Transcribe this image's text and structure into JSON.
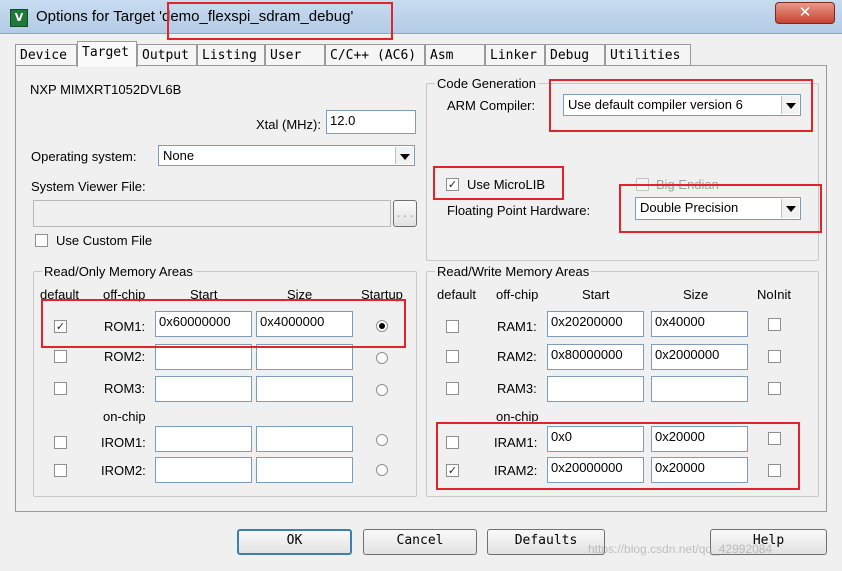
{
  "window": {
    "title_prefix": "Options for Target ",
    "title_target": "'demo_flexspi_sdram_debug'",
    "app_icon": "keil-icon",
    "close_label": "✕"
  },
  "tabs": [
    "Device",
    "Target",
    "Output",
    "Listing",
    "User",
    "C/C++ (AC6)",
    "Asm",
    "Linker",
    "Debug",
    "Utilities"
  ],
  "active_tab": "Target",
  "device_name": "NXP MIMXRT1052DVL6B",
  "xtal": {
    "label": "Xtal (MHz):",
    "value": "12.0"
  },
  "os": {
    "label": "Operating system:",
    "value": "None"
  },
  "svd": {
    "label": "System Viewer File:",
    "value": "",
    "browse_label": "..."
  },
  "use_custom_file": {
    "label": "Use Custom File",
    "checked": false
  },
  "code_generation": {
    "title": "Code Generation",
    "arm_compiler_label": "ARM Compiler:",
    "arm_compiler_value": "Use default compiler version 6",
    "use_microlib_label": "Use MicroLIB",
    "use_microlib_checked": true,
    "big_endian_label": "Big Endian",
    "big_endian_checked": false,
    "fph_label": "Floating Point Hardware:",
    "fph_value": "Double Precision"
  },
  "ro_memory": {
    "title": "Read/Only Memory Areas",
    "headers": {
      "default": "default",
      "offchip": "off-chip",
      "start": "Start",
      "size": "Size",
      "startup": "Startup"
    },
    "onchip_label": "on-chip",
    "rows": [
      {
        "label": "ROM1:",
        "default": true,
        "start": "0x60000000",
        "size": "0x4000000",
        "startup": true
      },
      {
        "label": "ROM2:",
        "default": false,
        "start": "",
        "size": "",
        "startup": false
      },
      {
        "label": "ROM3:",
        "default": false,
        "start": "",
        "size": "",
        "startup": false
      },
      {
        "label": "IROM1:",
        "default": false,
        "start": "",
        "size": "",
        "startup": false
      },
      {
        "label": "IROM2:",
        "default": false,
        "start": "",
        "size": "",
        "startup": false
      }
    ]
  },
  "rw_memory": {
    "title": "Read/Write Memory Areas",
    "headers": {
      "default": "default",
      "offchip": "off-chip",
      "start": "Start",
      "size": "Size",
      "noinit": "NoInit"
    },
    "onchip_label": "on-chip",
    "rows": [
      {
        "label": "RAM1:",
        "default": false,
        "start": "0x20200000",
        "size": "0x40000",
        "noinit": false
      },
      {
        "label": "RAM2:",
        "default": false,
        "start": "0x80000000",
        "size": "0x2000000",
        "noinit": false
      },
      {
        "label": "RAM3:",
        "default": false,
        "start": "",
        "size": "",
        "noinit": false
      },
      {
        "label": "IRAM1:",
        "default": false,
        "start": "0x0",
        "size": "0x20000",
        "noinit": false
      },
      {
        "label": "IRAM2:",
        "default": true,
        "start": "0x20000000",
        "size": "0x20000",
        "noinit": false
      }
    ]
  },
  "buttons": {
    "ok": "OK",
    "cancel": "Cancel",
    "defaults": "Defaults",
    "help": "Help"
  },
  "watermark": "https://blog.csdn.net/qq_42992084",
  "colors": {
    "highlight": "#e0242b",
    "titlebar": "#b9cfe8"
  }
}
